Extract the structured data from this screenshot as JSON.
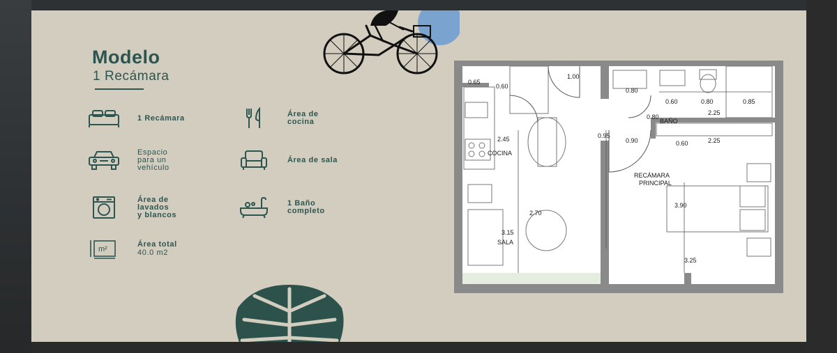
{
  "heading": {
    "title": "Modelo",
    "subtitle": "1 Recámara"
  },
  "features": [
    {
      "icon": "bed-icon",
      "label": "1 Recámara"
    },
    {
      "icon": "utensils-icon",
      "label": "Área de\ncocina"
    },
    {
      "icon": "car-icon",
      "label": "Espacio\npara un\nvehículo"
    },
    {
      "icon": "armchair-icon",
      "label": "Área de sala"
    },
    {
      "icon": "washing-machine-icon",
      "label": "Área de\nlavados\ny blancos"
    },
    {
      "icon": "bathtub-icon",
      "label": "1 Baño\ncompleto"
    },
    {
      "icon": "area-icon",
      "label": "Área total",
      "value": "40.0 m2"
    }
  ],
  "area_icon_text": "m²",
  "floorplan": {
    "rooms": {
      "kitchen": "COCINA",
      "living": "SALA",
      "bath": "BAÑO",
      "bedroom_1": "RECÁMARA",
      "bedroom_2": "PRINCIPAL"
    },
    "dimensions": {
      "d065": "0.65",
      "d060a": "0.60",
      "d100": "1.00",
      "d080a": "0.80",
      "d060b": "0.60",
      "d080b": "0.80",
      "d085": "0.85",
      "d080c": "0.80",
      "d225a": "2.25",
      "d245": "2.45",
      "d095": "0.95",
      "d090": "0.90",
      "d060c": "0.60",
      "d225b": "2.25",
      "d270": "2.70",
      "d315": "3.15",
      "d390": "3.90",
      "d325": "3.25"
    }
  },
  "colors": {
    "background": "#d2cdbf",
    "accent": "#2d5550",
    "sky": "#7aa3d0",
    "leaf": "#2c524b"
  }
}
